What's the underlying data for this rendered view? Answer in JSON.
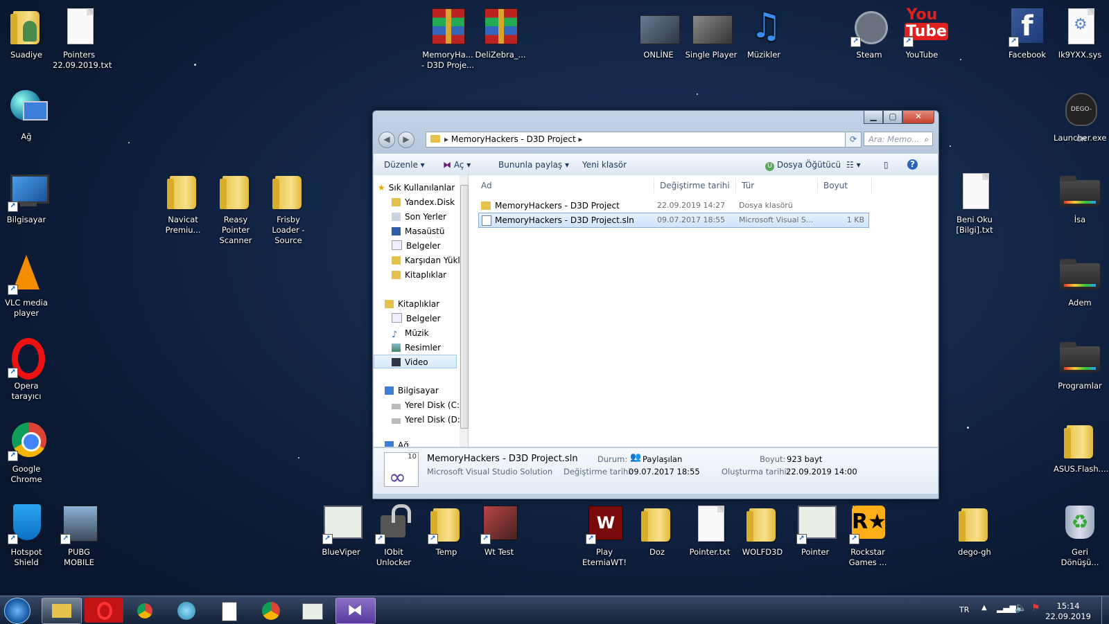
{
  "desktop": {
    "icons": [
      {
        "label": "Suadiye"
      },
      {
        "label": "Pointers 22.09.2019.txt"
      },
      {
        "label": "MemoryHa... - D3D Proje..."
      },
      {
        "label": "DeliZebra_..."
      },
      {
        "label": "ONLİNE"
      },
      {
        "label": "Single Player"
      },
      {
        "label": "Müzikler"
      },
      {
        "label": "Steam"
      },
      {
        "label": "YouTube"
      },
      {
        "label": "Facebook"
      },
      {
        "label": "Ik9YXX.sys"
      },
      {
        "label": "Ağ"
      },
      {
        "label": "Launcher.exe"
      },
      {
        "label": "Bilgisayar"
      },
      {
        "label": "Navicat Premiu..."
      },
      {
        "label": "Reasy Pointer Scanner"
      },
      {
        "label": "Frisby Loader - Source"
      },
      {
        "label": "Beni Oku [Bilgi].txt"
      },
      {
        "label": "İsa"
      },
      {
        "label": "VLC media player"
      },
      {
        "label": "Adem"
      },
      {
        "label": "Opera tarayıcı"
      },
      {
        "label": "Programlar"
      },
      {
        "label": "Google Chrome"
      },
      {
        "label": "ASUS.Flash...."
      },
      {
        "label": "Hotspot Shield"
      },
      {
        "label": "PUBG MOBILE"
      },
      {
        "label": "BlueViper"
      },
      {
        "label": "IObit Unlocker"
      },
      {
        "label": "Temp"
      },
      {
        "label": "Wt Test"
      },
      {
        "label": "Play EterniaWT!"
      },
      {
        "label": "Doz"
      },
      {
        "label": "Pointer.txt"
      },
      {
        "label": "WOLFD3D"
      },
      {
        "label": "Pointer"
      },
      {
        "label": "Rockstar Games ..."
      },
      {
        "label": "dego-gh"
      },
      {
        "label": "Geri Dönüşü..."
      }
    ]
  },
  "explorer": {
    "address": {
      "folder": "MemoryHackers - D3D Project"
    },
    "search_placeholder": "Ara: Memo...",
    "toolbar": {
      "organize": "Düzenle",
      "open": "Aç",
      "share": "Bununla paylaş",
      "new_folder": "Yeni klasör",
      "vs": "Dosya Öğütücü"
    },
    "nav": {
      "favorites": "Sık Kullanılanlar",
      "fav_items": [
        "Yandex.Disk",
        "Son Yerler",
        "Masaüstü",
        "Belgeler",
        "Karşıdan Yükl",
        "Kitaplıklar"
      ],
      "libraries": "Kitaplıklar",
      "lib_items": [
        "Belgeler",
        "Müzik",
        "Resimler",
        "Video"
      ],
      "computer": "Bilgisayar",
      "comp_items": [
        "Yerel Disk (C:)",
        "Yerel Disk (D:)"
      ],
      "network": "Ağ"
    },
    "columns": {
      "name": "Ad",
      "date": "Değiştirme tarihi",
      "type": "Tür",
      "size": "Boyut"
    },
    "files": [
      {
        "name": "MemoryHackers - D3D Project",
        "date": "22.09.2019 14:27",
        "type": "Dosya klasörü",
        "size": ""
      },
      {
        "name": "MemoryHackers - D3D Project.sln",
        "date": "09.07.2017 18:55",
        "type": "Microsoft Visual S...",
        "size": "1 KB"
      }
    ],
    "details": {
      "filename": "MemoryHackers - D3D Project.sln",
      "filetype": "Microsoft Visual Studio Solution",
      "badge": "10",
      "state_label": "Durum:",
      "state_value": "Paylaşılan",
      "modified_label": "Değiştirme tarihi:",
      "modified_value": "09.07.2017 18:55",
      "size_label": "Boyut:",
      "size_value": "923 bayt",
      "created_label": "Oluşturma tarihi:",
      "created_value": "22.09.2019 14:00"
    }
  },
  "taskbar": {
    "lang": "TR",
    "time": "15:14",
    "date": "22.09.2019"
  }
}
